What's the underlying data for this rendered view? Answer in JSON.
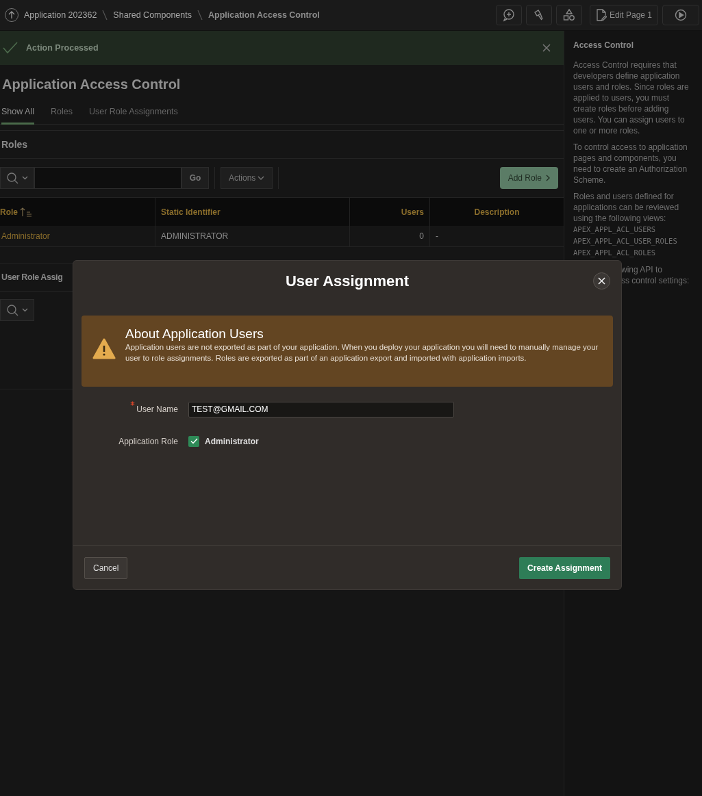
{
  "breadcrumbs": [
    {
      "label": "Application 202362",
      "current": false
    },
    {
      "label": "Shared Components",
      "current": false
    },
    {
      "label": "Application Access Control",
      "current": true
    }
  ],
  "toolbar": {
    "edit_page": "Edit Page 1"
  },
  "alert": {
    "message": "Action Processed"
  },
  "page_title": "Application Access Control",
  "tabs": [
    {
      "label": "Show All",
      "selected": true
    },
    {
      "label": "Roles",
      "selected": false
    },
    {
      "label": "User Role Assignments",
      "selected": false
    }
  ],
  "roles_region": {
    "title": "Roles",
    "go_button": "Go",
    "actions_button": "Actions",
    "add_button": "Add Role",
    "columns": [
      {
        "label": "Role",
        "sorted": true
      },
      {
        "label": "Static Identifier",
        "sorted": false
      },
      {
        "label": "Users",
        "sorted": false
      },
      {
        "label": "Description",
        "sorted": false
      }
    ],
    "rows": [
      [
        "Administrator",
        "ADMINISTRATOR",
        "0",
        "-"
      ]
    ]
  },
  "assignments_region": {
    "title": "User Role Assig"
  },
  "help": {
    "title": "Access Control",
    "paragraphs": [
      "Access Control requires that developers define application users and roles. Since roles are applied to users, you must create roles before adding users. You can assign users to one or more roles.",
      "To control access to application pages and components, you need to create an Authorization Scheme.",
      "Roles and users defined for applications can be reviewed using the following views:"
    ],
    "views": [
      "APEX_APPL_ACL_USERS",
      "APEX_APPL_ACL_USER_ROLES",
      "APEX_APPL_ACL_ROLES"
    ],
    "covered_lines": [
      "wing API to",
      "ss control settings:"
    ]
  },
  "dialog": {
    "title": "User Assignment",
    "notice": {
      "title": "About Application Users",
      "text": "Application users are not exported as part of your application. When you deploy your application you will need to manually manage your user to role assignments. Roles are exported as part of an application export and imported with application imports."
    },
    "fields": [
      {
        "kind": "text",
        "label": "User Name",
        "required": true,
        "value": "TEST@GMAIL.COM"
      },
      {
        "kind": "checkbox",
        "label": "Application Role",
        "required": false,
        "options": [
          {
            "label": "Administrator",
            "checked": true
          }
        ]
      }
    ],
    "buttons": [
      {
        "label": "Cancel",
        "kind": "secondary"
      },
      {
        "label": "Create Assignment",
        "kind": "primary"
      }
    ]
  }
}
